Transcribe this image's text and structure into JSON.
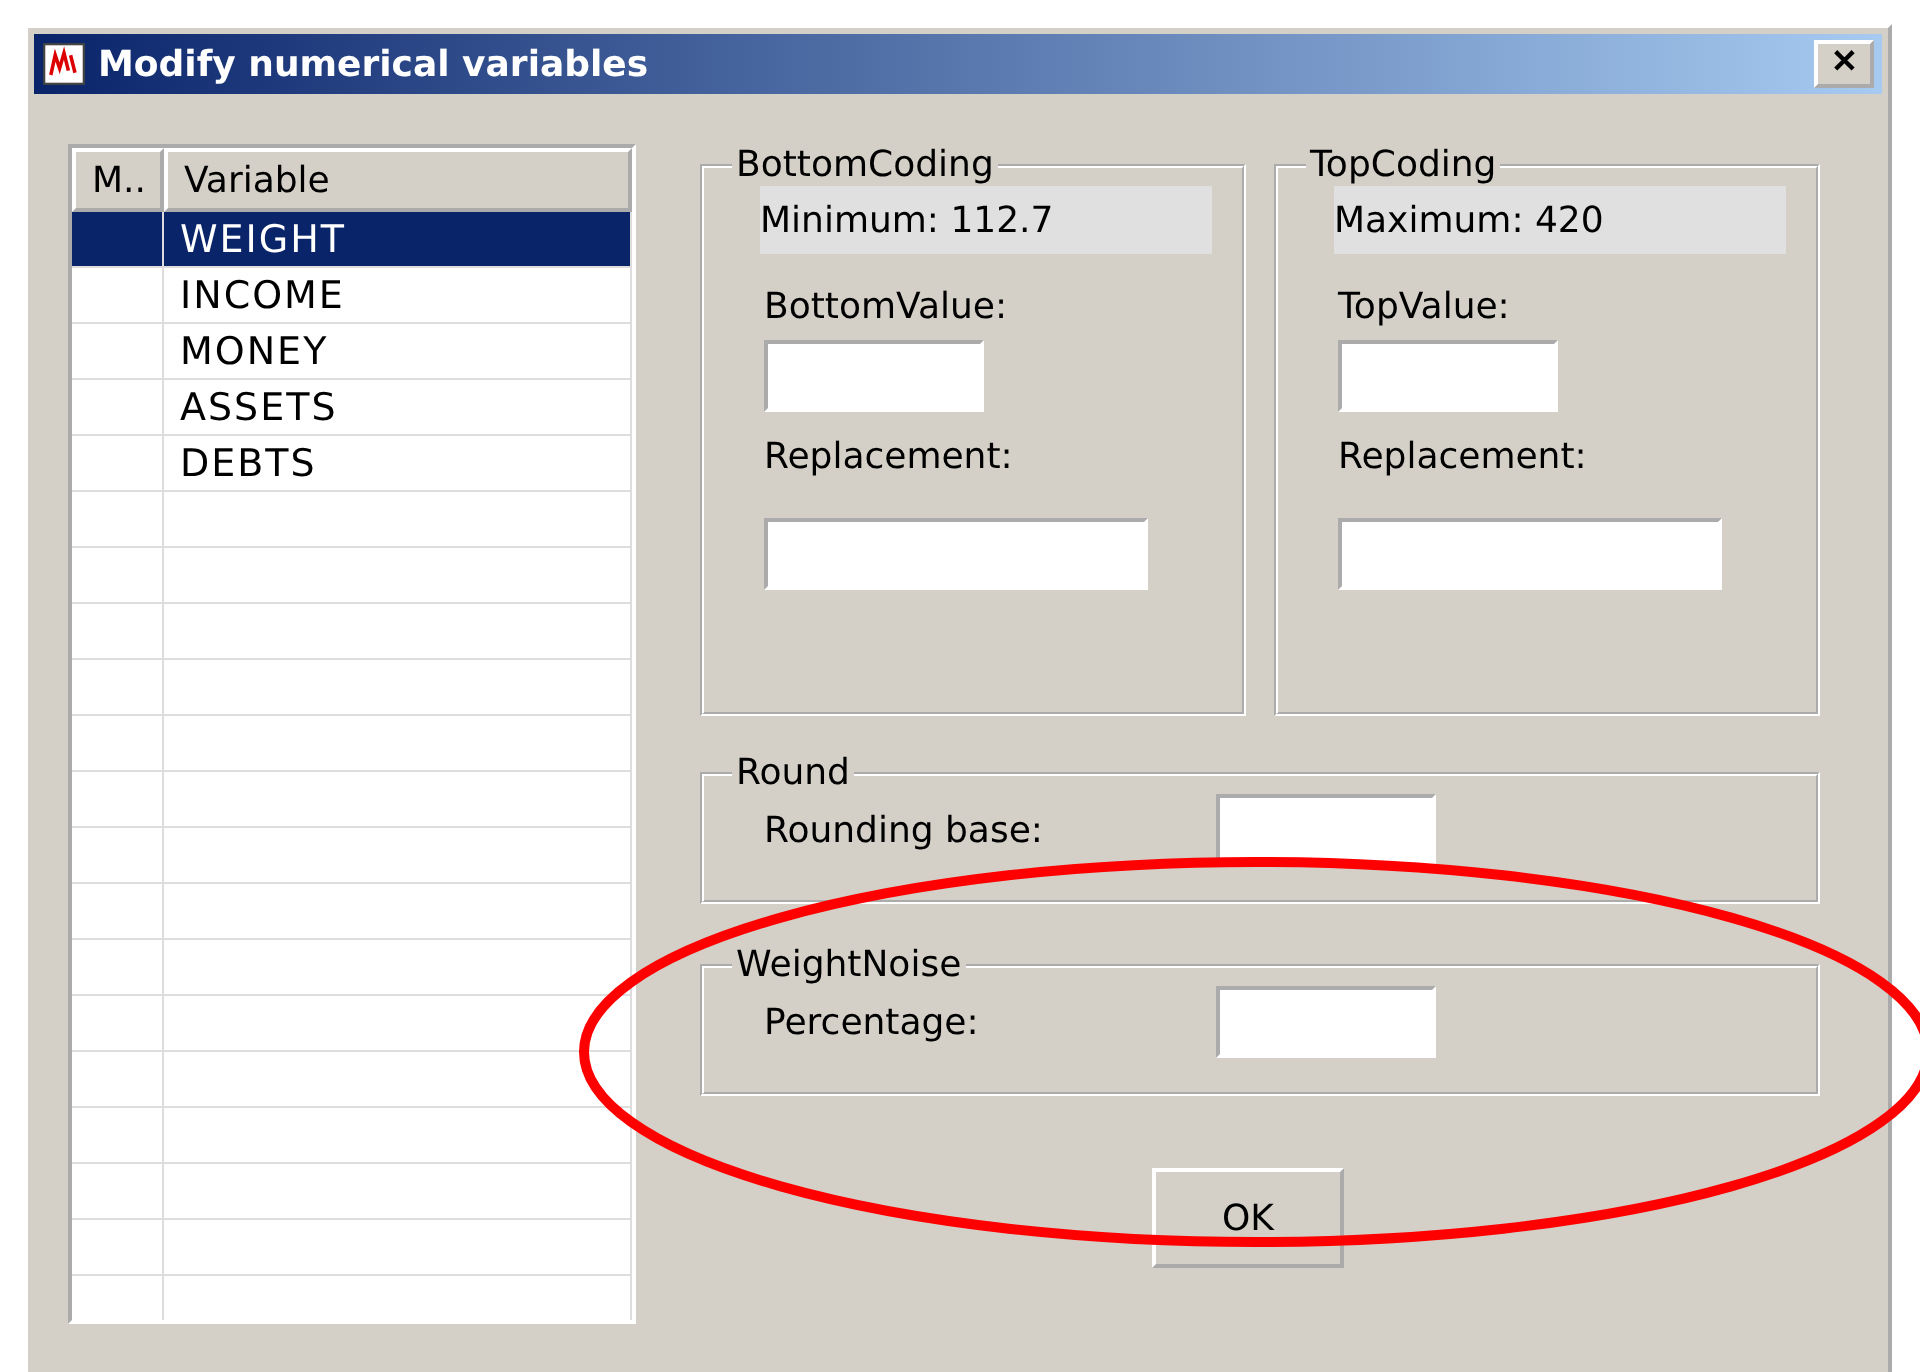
{
  "window": {
    "title": "Modify numerical variables",
    "close_glyph": "✕"
  },
  "table": {
    "columns": [
      "M..",
      "Variable"
    ],
    "rows": [
      {
        "marker": "",
        "variable": "WEIGHT",
        "selected": true
      },
      {
        "marker": "",
        "variable": "INCOME",
        "selected": false
      },
      {
        "marker": "",
        "variable": "MONEY",
        "selected": false
      },
      {
        "marker": "",
        "variable": "ASSETS",
        "selected": false
      },
      {
        "marker": "",
        "variable": "DEBTS",
        "selected": false
      }
    ]
  },
  "bottom_coding": {
    "title": "BottomCoding",
    "info": "Minimum:  112.7",
    "value_label": "BottomValue:",
    "replacement_label": "Replacement:"
  },
  "top_coding": {
    "title": "TopCoding",
    "info": "Maximum:  420",
    "value_label": "TopValue:",
    "replacement_label": "Replacement:"
  },
  "round": {
    "title": "Round",
    "label": "Rounding base:"
  },
  "weight_noise": {
    "title": "WeightNoise",
    "label": "Percentage:"
  },
  "ok_button": "OK"
}
